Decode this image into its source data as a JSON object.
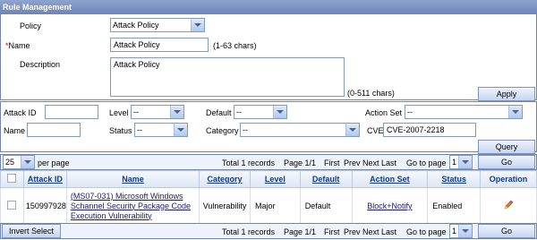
{
  "title": "Rule Management",
  "form": {
    "policy_label": "Policy",
    "policy_value": "Attack Policy",
    "name_required_mark": "*",
    "name_label": "Name",
    "name_value": "Attack Policy",
    "name_hint": "(1-63   chars)",
    "description_label": "Description",
    "description_value": "Attack Policy",
    "description_hint": "(0-511   chars)",
    "apply_label": "Apply"
  },
  "search": {
    "attack_id_label": "Attack ID",
    "attack_id_value": "",
    "level_label": "Level",
    "level_value": "--",
    "default_label": "Default",
    "default_value": "--",
    "action_set_label": "Action Set",
    "action_set_value": "--",
    "name_label": "Name",
    "name_value": "",
    "status_label": "Status",
    "status_value": "--",
    "category_label": "Category",
    "category_value": "--",
    "cve_label": "CVE",
    "cve_value": "CVE-2007-2218",
    "query_label": "Query"
  },
  "pager": {
    "per_page_value": "25",
    "per_page_label": "per page",
    "total_records": "Total 1 records",
    "page_info": "Page 1/1",
    "first": "First",
    "prev": "Prev",
    "next": "Next",
    "last": "Last",
    "goto_label": "Go to page",
    "goto_value": "1",
    "go_label": "Go"
  },
  "table": {
    "headers": {
      "attack_id": "Attack ID",
      "name": "Name",
      "category": "Category",
      "level": "Level",
      "default": "Default",
      "action_set": "Action Set",
      "status": "Status",
      "operation": "Operation"
    },
    "rows": [
      {
        "attack_id": "150997928",
        "name": "(MS07-031) Microsoft Windows Schannel Security Package Code Execution Vulnerability",
        "category": "Vulnerability",
        "level": "Major",
        "default": "Default",
        "action_set": "Block+Notify",
        "status": "Enabled",
        "operation_icon": "edit-pencil-icon"
      }
    ]
  },
  "footer": {
    "invert_select_label": "Invert Select"
  }
}
